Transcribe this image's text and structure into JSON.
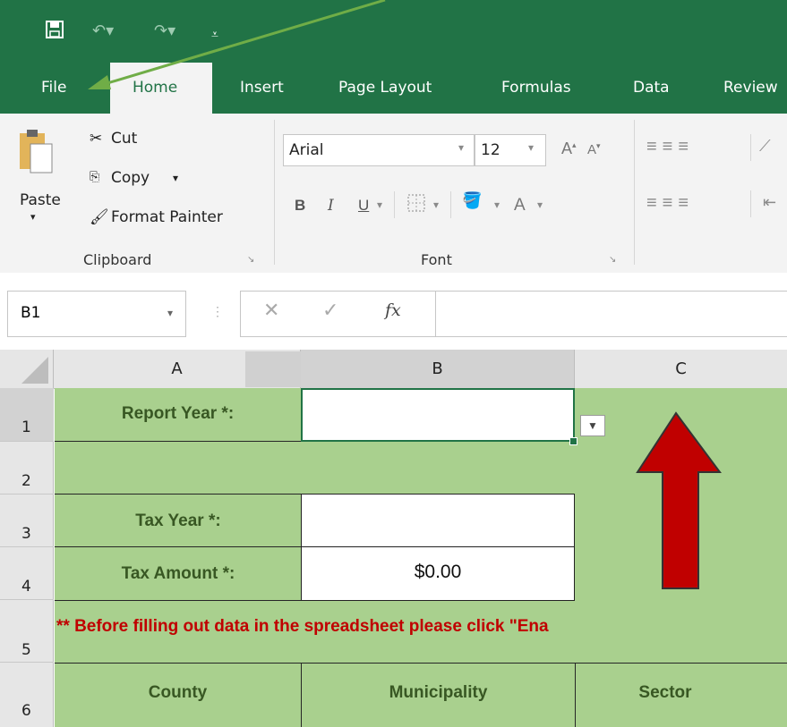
{
  "quick_access": {
    "save_icon": "save-icon",
    "undo_icon": "undo-icon",
    "redo_icon": "redo-icon",
    "customize_icon": "customize-icon"
  },
  "tabs": {
    "file": "File",
    "home": "Home",
    "insert": "Insert",
    "page_layout": "Page Layout",
    "formulas": "Formulas",
    "data": "Data",
    "review": "Review"
  },
  "clipboard": {
    "paste": "Paste",
    "cut": "Cut",
    "copy": "Copy",
    "format_painter": "Format Painter",
    "group_label": "Clipboard"
  },
  "font": {
    "name": "Arial",
    "size": "12",
    "bold": "B",
    "italic": "I",
    "underline": "U",
    "font_color": "A",
    "grow": "A",
    "shrink": "A",
    "group_label": "Font"
  },
  "formula_bar": {
    "name_box": "B1",
    "fx": "fx",
    "content": ""
  },
  "columns": [
    "A",
    "B",
    "C"
  ],
  "rows": [
    "1",
    "2",
    "3",
    "4",
    "5",
    "6"
  ],
  "sheet": {
    "report_year_label": "Report Year *:",
    "report_year_value": "",
    "tax_year_label": "Tax Year *:",
    "tax_year_value": "",
    "tax_amount_label": "Tax Amount *:",
    "tax_amount_value": "$0.00",
    "notice": "** Before filling out data in the spreadsheet please click \"Ena",
    "header_county": "County",
    "header_municipality": "Municipality",
    "header_sector": "Sector"
  },
  "colors": {
    "excel_green": "#217346",
    "sheet_green": "#a9d08e",
    "label_green": "#385723",
    "notice_red": "#c00000",
    "arrow_red": "#c00000",
    "annotation_arrow": "#70ad47"
  }
}
